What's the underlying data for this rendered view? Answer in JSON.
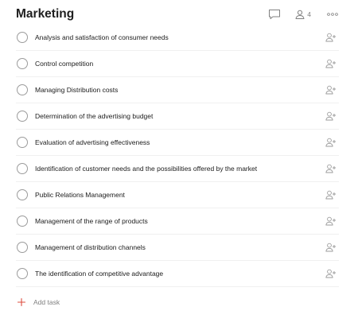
{
  "project": {
    "title": "Marketing",
    "member_count": "4"
  },
  "icons": {
    "comment": "comment-icon",
    "members": "person-icon",
    "more": "more-horizontal-icon",
    "complete": "circle-checkbox-icon",
    "assign": "assign-person-plus-icon",
    "add": "plus-icon"
  },
  "colors": {
    "accent": "#dc4c3e",
    "icon_gray": "#9b9b9b",
    "text": "#202020",
    "muted": "#808080"
  },
  "tasks": [
    {
      "label": "Analysis and satisfaction of consumer needs"
    },
    {
      "label": "Control competition"
    },
    {
      "label": "Managing Distribution costs"
    },
    {
      "label": "Determination of the advertising budget"
    },
    {
      "label": "Evaluation of advertising effectiveness"
    },
    {
      "label": "Identification of customer needs and the possibilities offered by the market"
    },
    {
      "label": "Public Relations Management"
    },
    {
      "label": "Management of the range of products"
    },
    {
      "label": "Management of distribution channels"
    },
    {
      "label": "The identification of competitive advantage"
    }
  ],
  "add_task": {
    "label": "Add task"
  }
}
